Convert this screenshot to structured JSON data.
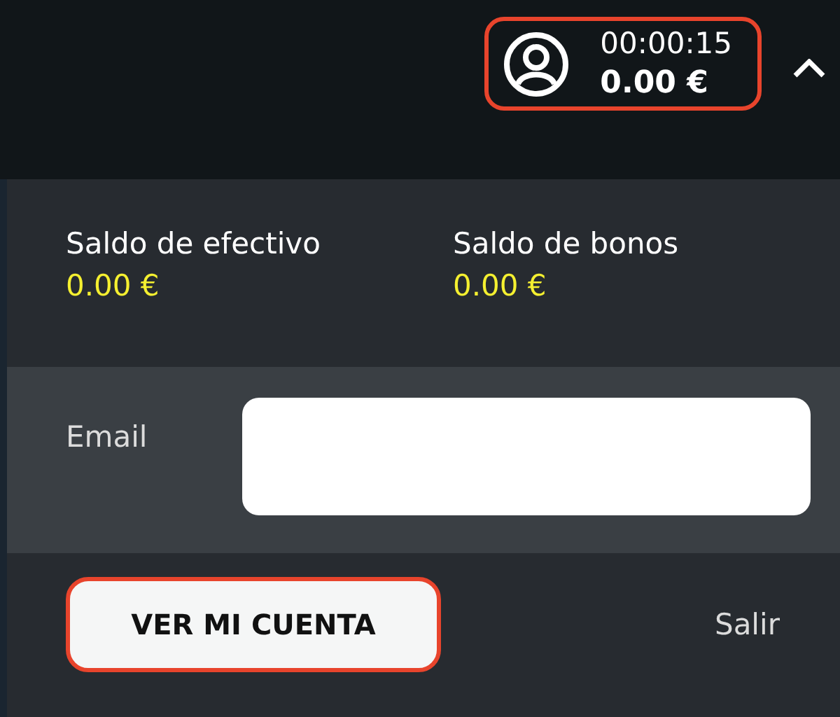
{
  "header": {
    "account": {
      "timer": "00:00:15",
      "balance": "0.00 €",
      "highlighted": true
    },
    "expanded": true
  },
  "balances": [
    {
      "label": "Saldo de efectivo",
      "amount": "0.00 €"
    },
    {
      "label": "Saldo de bonos",
      "amount": "0.00 €"
    }
  ],
  "email": {
    "label": "Email"
  },
  "actions": {
    "account_button": {
      "label": "VER MI CUENTA",
      "highlighted": true
    },
    "logout": "Salir"
  }
}
